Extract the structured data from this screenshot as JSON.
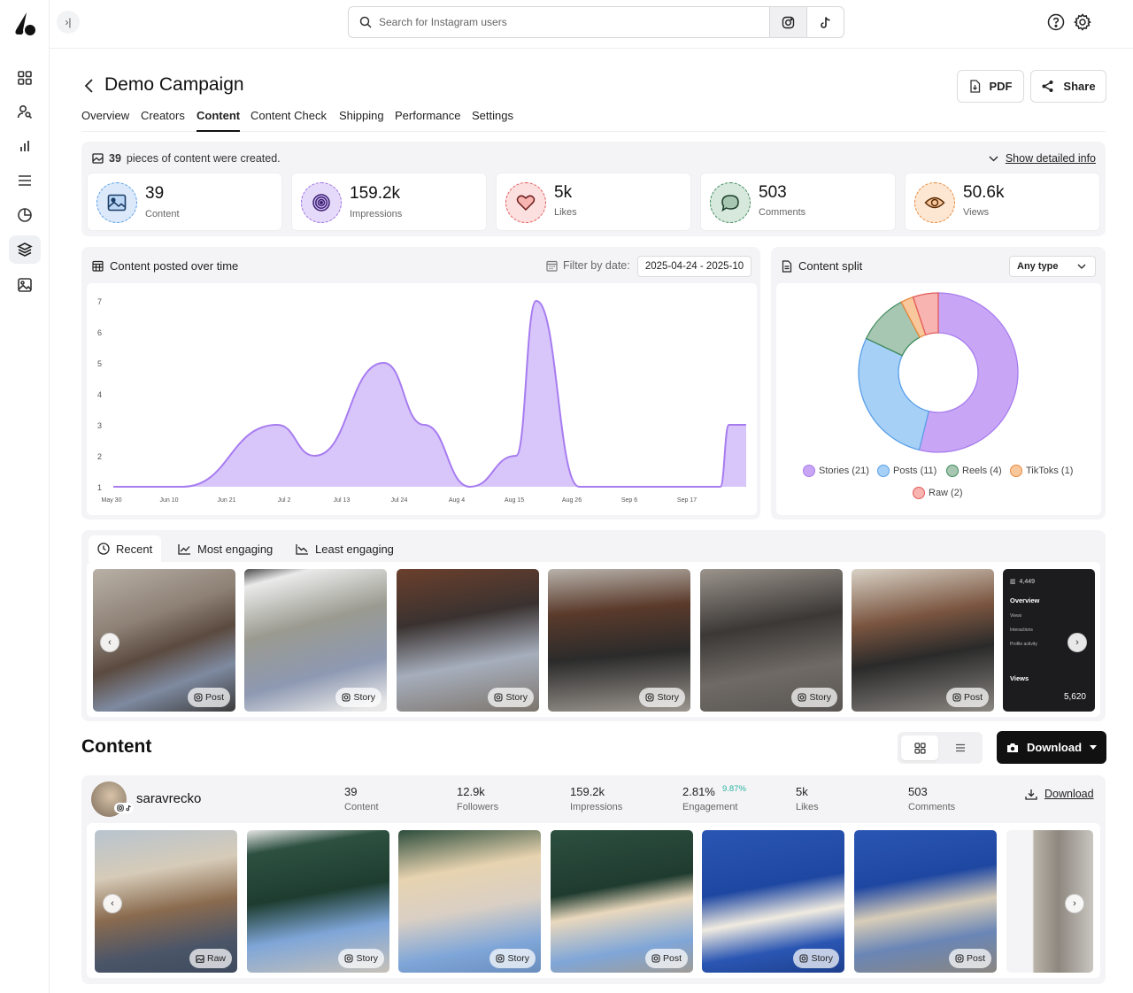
{
  "search": {
    "placeholder": "Search for Instagram users"
  },
  "header": {
    "title": "Demo Campaign",
    "pdf_label": "PDF",
    "share_label": "Share"
  },
  "tabs": [
    {
      "label": "Overview"
    },
    {
      "label": "Creators"
    },
    {
      "label": "Content"
    },
    {
      "label": "Content Check"
    },
    {
      "label": "Shipping"
    },
    {
      "label": "Performance"
    },
    {
      "label": "Settings"
    }
  ],
  "summary": {
    "count": "39",
    "text": "pieces of content were created.",
    "detail_link": "Show detailed info"
  },
  "stats": [
    {
      "value": "39",
      "label": "Content",
      "icon": "image-icon",
      "color": "#5aa0e8"
    },
    {
      "value": "159.2k",
      "label": "Impressions",
      "icon": "target-icon",
      "color": "#9b6fe0"
    },
    {
      "value": "5k",
      "label": "Likes",
      "icon": "heart-icon",
      "color": "#e45a5a"
    },
    {
      "value": "503",
      "label": "Comments",
      "icon": "comment-icon",
      "color": "#3f8a5c"
    },
    {
      "value": "50.6k",
      "label": "Views",
      "icon": "eye-icon",
      "color": "#e8883a"
    }
  ],
  "timeline": {
    "title": "Content posted over time",
    "filter_label": "Filter by date:",
    "date_range": "2025-04-24 - 2025-10"
  },
  "split": {
    "title": "Content split",
    "type_select": "Any type"
  },
  "chart_data": [
    {
      "type": "area",
      "title": "Content posted over time",
      "x": [
        "May 30",
        "Jun 10",
        "Jun 21",
        "Jul 2",
        "Jul 13",
        "Jul 24",
        "Aug 4",
        "Aug 15",
        "Aug 26",
        "Sep 6",
        "Sep 17",
        ""
      ],
      "x_ticks": [
        "May 30",
        "Jun 10",
        "Jun 21",
        "Jul 2",
        "Jul 13",
        "Jul 24",
        "Aug 4",
        "Aug 15",
        "Aug 26",
        "Sep 6",
        "Sep 17"
      ],
      "y_ticks": [
        1,
        2,
        3,
        4,
        5,
        6,
        7
      ],
      "ylim": [
        1,
        7
      ],
      "points": [
        {
          "x": 0,
          "y": 1
        },
        {
          "x": 1.2,
          "y": 1
        },
        {
          "x": 2.85,
          "y": 3
        },
        {
          "x": 3.5,
          "y": 2
        },
        {
          "x": 4.7,
          "y": 5
        },
        {
          "x": 5.4,
          "y": 3
        },
        {
          "x": 6.2,
          "y": 1
        },
        {
          "x": 7.0,
          "y": 2
        },
        {
          "x": 7.35,
          "y": 7
        },
        {
          "x": 8.1,
          "y": 1
        },
        {
          "x": 10.55,
          "y": 1
        },
        {
          "x": 10.7,
          "y": 3
        },
        {
          "x": 11.0,
          "y": 3
        }
      ],
      "color": "#a77cf0",
      "fill": "#d8c6fb"
    },
    {
      "type": "pie",
      "title": "Content split",
      "donut": true,
      "slices": [
        {
          "label": "Stories",
          "value": 21,
          "color": "#c9a6f5",
          "stroke": "#a77cf0"
        },
        {
          "label": "Posts",
          "value": 11,
          "color": "#a7d0f7",
          "stroke": "#5aa0e8"
        },
        {
          "label": "Reels",
          "value": 4,
          "color": "#a8c7b2",
          "stroke": "#3f8a5c"
        },
        {
          "label": "TikToks",
          "value": 1,
          "color": "#f9c79c",
          "stroke": "#e8883a"
        },
        {
          "label": "Raw",
          "value": 2,
          "color": "#f7b4b0",
          "stroke": "#e45a5a"
        }
      ],
      "legend": [
        "Stories (21)",
        "Posts (11)",
        "Reels (4)",
        "TikToks (1)",
        "Raw (2)"
      ]
    }
  ],
  "recent_tabs": [
    {
      "label": "Recent",
      "icon": "clock-icon"
    },
    {
      "label": "Most engaging",
      "icon": "trend-up-icon"
    },
    {
      "label": "Least engaging",
      "icon": "trend-down-icon"
    }
  ],
  "recent_items": [
    {
      "badge": "Post",
      "icon": "instagram-icon"
    },
    {
      "badge": "Story",
      "icon": "instagram-icon"
    },
    {
      "badge": "Story",
      "icon": "instagram-icon"
    },
    {
      "badge": "Story",
      "icon": "instagram-icon"
    },
    {
      "badge": "Story",
      "icon": "instagram-icon"
    },
    {
      "badge": "Post",
      "icon": "instagram-icon"
    }
  ],
  "insight_thumb": {
    "count": "4,449",
    "overview": "Overview",
    "views_label": "Views",
    "views_value": "5,620",
    "rows": [
      "Views",
      "Interactions",
      "Profile activity"
    ]
  },
  "content_section": {
    "title": "Content",
    "download_label": "Download"
  },
  "creator": {
    "name": "saravrecko",
    "stats": [
      {
        "value": "39",
        "label": "Content"
      },
      {
        "value": "12.9k",
        "label": "Followers"
      },
      {
        "value": "159.2k",
        "label": "Impressions"
      },
      {
        "value": "2.81%",
        "label": "Engagement"
      },
      {
        "value": "5k",
        "label": "Likes"
      },
      {
        "value": "503",
        "label": "Comments"
      }
    ],
    "engagement_delta": "9.87%",
    "download_label": "Download",
    "items": [
      {
        "badge": "Raw",
        "icon": "image-icon"
      },
      {
        "badge": "Story",
        "icon": "instagram-icon"
      },
      {
        "badge": "Story",
        "icon": "instagram-icon"
      },
      {
        "badge": "Post",
        "icon": "instagram-icon"
      },
      {
        "badge": "Story",
        "icon": "instagram-icon"
      },
      {
        "badge": "Post",
        "icon": "instagram-icon"
      }
    ]
  }
}
